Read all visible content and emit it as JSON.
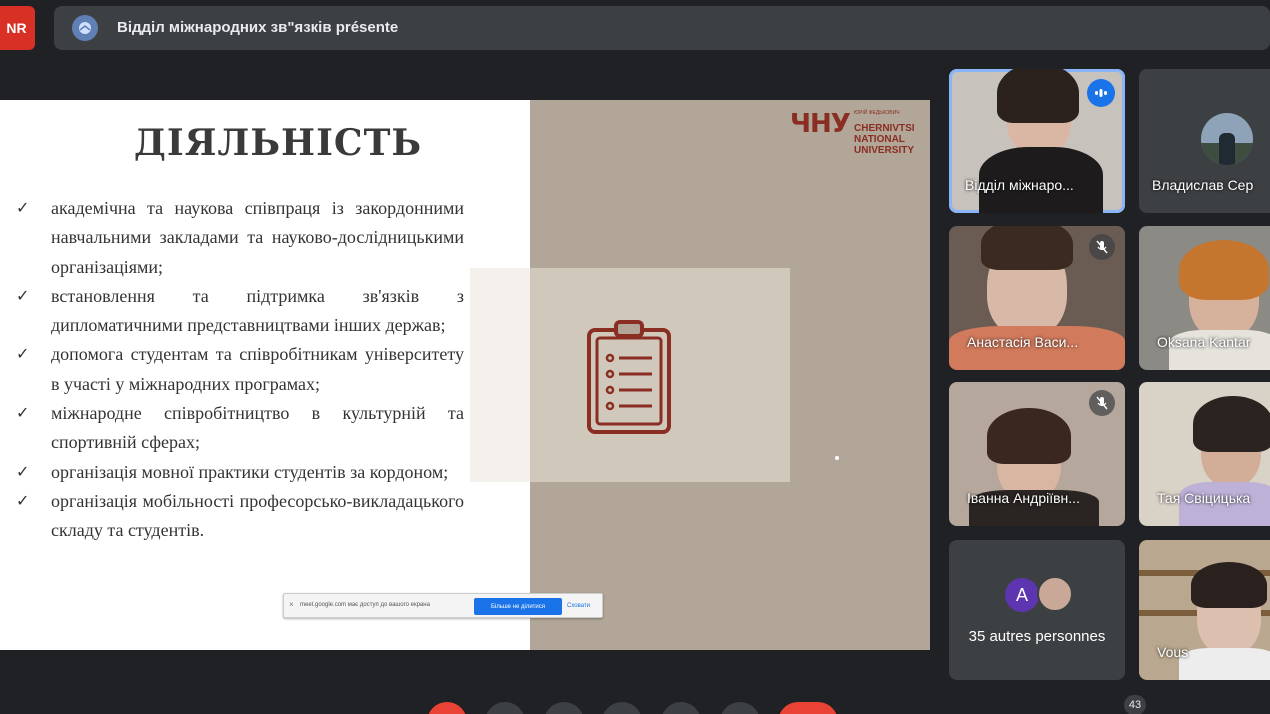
{
  "header": {
    "user_initials": "NR",
    "presenter_title": "Відділ міжнародних зв\"язків présente"
  },
  "slide": {
    "title": "ДІЯЛЬНІСТЬ",
    "bullets": [
      "академічна та наукова співпраця із закордонними навчальними закладами та науково-дослідницькими організаціями;",
      "встановлення та підтримка зв'язків з дипломатичними представництвами інших держав;",
      "допомога студентам та співробітникам університету в участі у міжнародних програмах;",
      "міжнародне співробітництво в культурній та спортивній сферах;",
      "організація мовної практики студентів за кордоном;",
      "організація мобільності професорсько-викладацького складу та студентів."
    ],
    "check_glyph": "✓",
    "logo_mark": "ЧНУ",
    "logo_small": "ЮРІЙ ФЕДЬКОВИЧ",
    "logo_name": "CHERNIVTSI NATIONAL UNIVERSITY",
    "icon": "clipboard-list-icon"
  },
  "share_banner": {
    "close": "×",
    "text": "meet.google.com має доступ до вашого екрана",
    "stop_label": "Більше не ділитися",
    "hide_label": "Сховати"
  },
  "participants": [
    {
      "name": "Відділ міжнаро...",
      "speaking": true
    },
    {
      "name": "Владислав Сер",
      "muted": false
    },
    {
      "name": "Анастасія Васи...",
      "muted": true
    },
    {
      "name": "Oksana Kantar",
      "muted": false
    },
    {
      "name": "Іванна Андріївн...",
      "muted": true
    },
    {
      "name": "Тая Свіцицька",
      "muted": false
    },
    {
      "name": "Vous",
      "muted": false
    }
  ],
  "others": {
    "initial": "A",
    "label": "35 autres personnes"
  },
  "participant_count": "43",
  "colors": {
    "background": "#202124",
    "tile": "#3c4043",
    "accent_blue": "#1a73e8",
    "danger_red": "#ea4335",
    "brand_maroon": "#8a2d22",
    "slide_beige": "#b1a697"
  }
}
